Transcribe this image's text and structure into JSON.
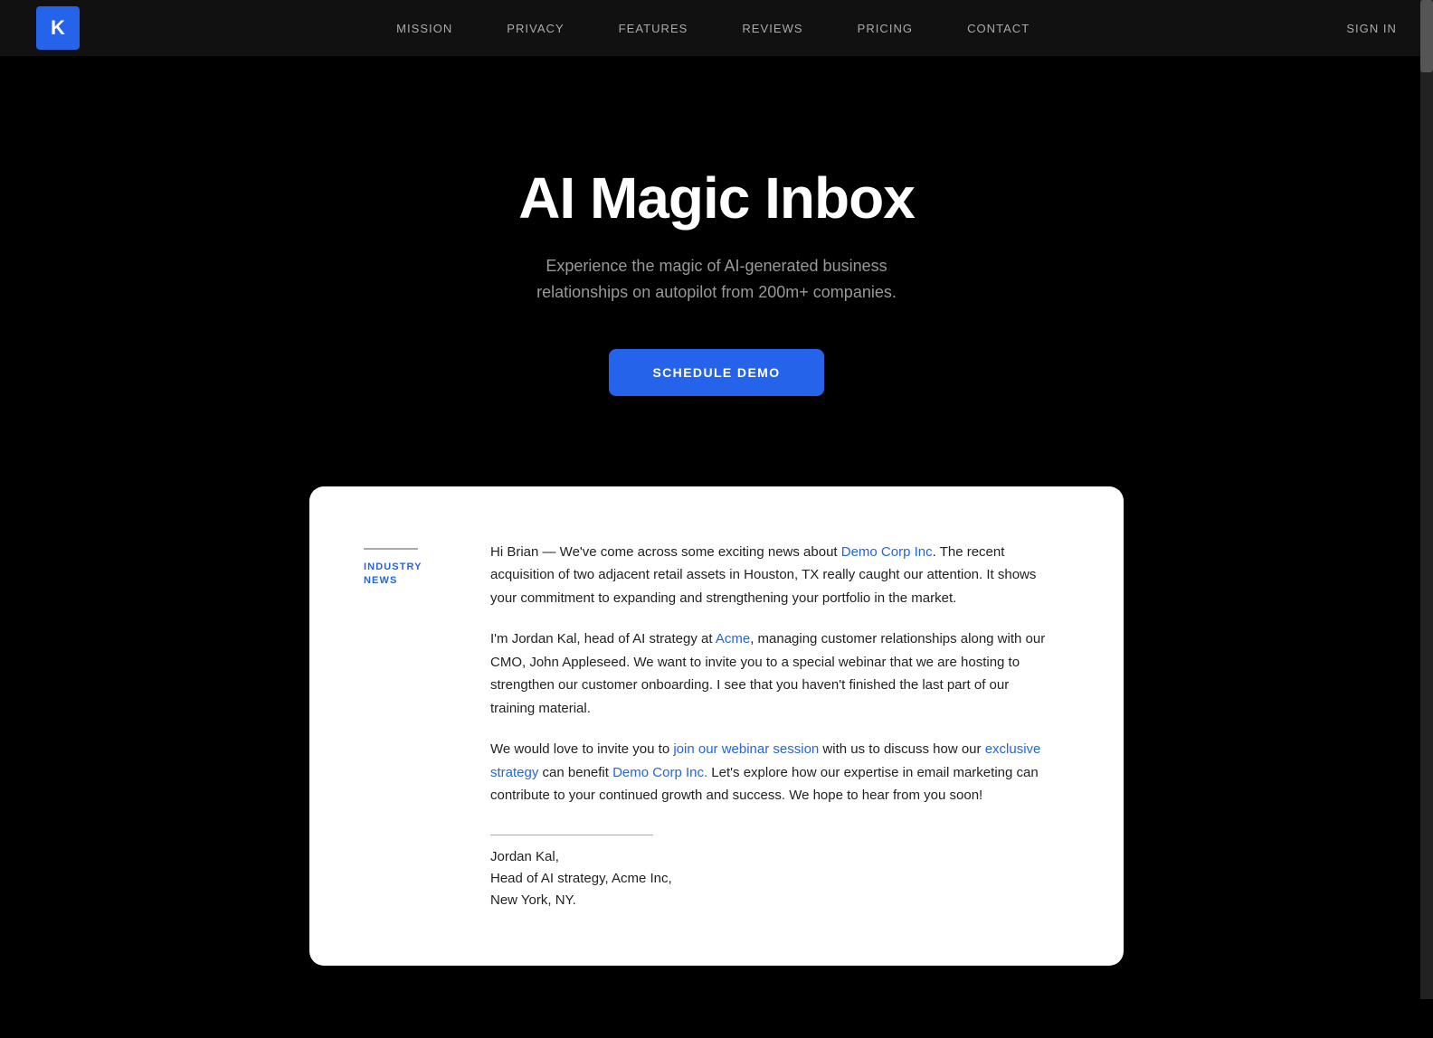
{
  "nav": {
    "logo": "K",
    "links": [
      {
        "label": "MISSION",
        "id": "mission"
      },
      {
        "label": "PRIVACY",
        "id": "privacy"
      },
      {
        "label": "FEATURES",
        "id": "features"
      },
      {
        "label": "REVIEWS",
        "id": "reviews"
      },
      {
        "label": "PRICING",
        "id": "pricing"
      },
      {
        "label": "CONTACT",
        "id": "contact"
      }
    ],
    "signin_label": "SIGN IN"
  },
  "hero": {
    "title": "AI Magic Inbox",
    "subtitle": "Experience the magic of AI-generated business relationships on autopilot from 200m+ companies.",
    "cta_label": "SCHEDULE DEMO"
  },
  "email_card": {
    "tag": "INDUSTRY NEWS",
    "paragraphs": [
      "Hi Brian — We've come across some exciting news about Demo Corp Inc. The recent acquisition of two adjacent retail assets in Houston, TX really caught our attention. It shows your commitment to expanding and strengthening your portfolio in the market.",
      "I'm Jordan Kal, head of AI strategy at Acme, managing customer relationships along with our CMO, John Appleseed. We want to invite you to a special webinar that we are hosting to strengthen our customer onboarding. I see that you haven't finished the last part of our training material.",
      "We would love to invite you to join our webinar session with us to discuss how our exclusive strategy can benefit Demo Corp Inc. Let's explore how our expertise in email marketing can contribute to your continued growth and success. We hope to hear from you soon!"
    ],
    "links": {
      "demo_corp_1": "Demo Corp Inc",
      "acme": "Acme",
      "join_webinar": "join our webinar session",
      "exclusive_strategy": "exclusive strategy",
      "demo_corp_2": "Demo Corp Inc."
    },
    "signature": {
      "name": "Jordan Kal,",
      "title": "Head of AI strategy, Acme Inc,",
      "location": "New York, NY."
    }
  }
}
